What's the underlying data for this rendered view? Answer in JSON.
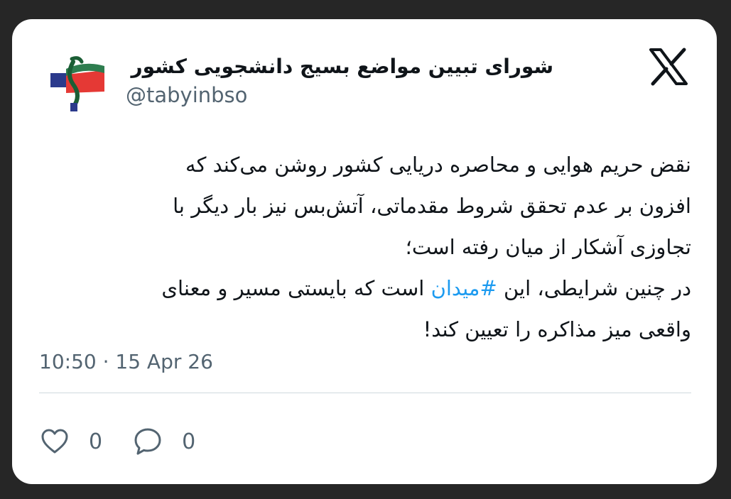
{
  "tweet": {
    "author_name": "شورای تبیین مواضع بسیج دانشجویی کشور",
    "author_handle": "@tabyinbso",
    "body_lines": [
      "نقض حریم هوایی و محاصره دریایی کشور روشن می‌کند که",
      "افزون بر عدم تحقق شروط مقدماتی، آتش‌بس نیز بار دیگر با",
      "تجاوزی آشکار از میان رفته است؛",
      {
        "before": "در چنین شرایطی، این ",
        "hashtag": "#میدان",
        "after": " است که بایستی مسیر و معنای"
      },
      "واقعی میز مذاکره را تعیین کند!"
    ],
    "timestamp": "10:50 · 15 Apr 26",
    "likes": "0",
    "replies": "0"
  },
  "icons": {
    "platform": "x-logo-icon",
    "like": "heart-icon",
    "reply": "speech-bubble-icon"
  },
  "colors": {
    "background": "#262626",
    "card": "#ffffff",
    "text": "#0f1419",
    "secondary_text": "#536471",
    "hashtag": "#1d9bf0",
    "divider": "#cfd9de"
  }
}
